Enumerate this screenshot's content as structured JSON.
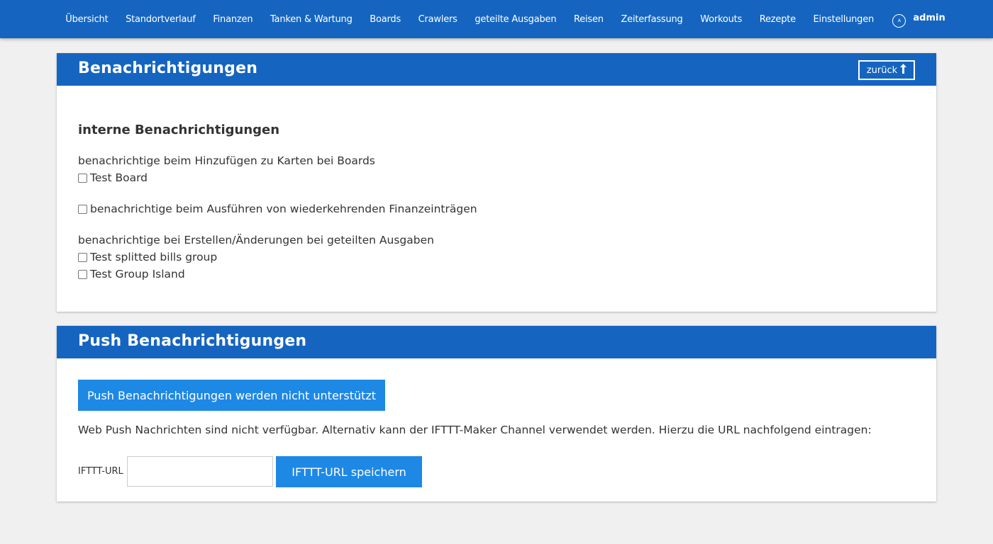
{
  "nav": {
    "items": [
      {
        "label": "Übersicht"
      },
      {
        "label": "Standortverlauf"
      },
      {
        "label": "Finanzen"
      },
      {
        "label": "Tanken & Wartung"
      },
      {
        "label": "Boards"
      },
      {
        "label": "Crawlers"
      },
      {
        "label": "geteilte Ausgaben"
      },
      {
        "label": "Reisen"
      },
      {
        "label": "Zeiterfassung"
      },
      {
        "label": "Workouts"
      },
      {
        "label": "Rezepte"
      },
      {
        "label": "Einstellungen"
      }
    ],
    "user": {
      "avatar_letter": "A",
      "name": "admin"
    }
  },
  "notifications": {
    "title": "Benachrichtigungen",
    "back_label": "zurück",
    "back_icon": "arrow-up-icon",
    "internal_heading": "interne Benachrichtigungen",
    "boards_label": "benachrichtige beim Hinzufügen zu Karten bei Boards",
    "boards_items": [
      {
        "label": "Test Board",
        "checked": false
      }
    ],
    "finance_label": "benachrichtige beim Ausführen von wiederkehrenden Finanzeinträgen",
    "finance_checked": false,
    "splitbills_label": "benachrichtige bei Erstellen/Änderungen bei geteilten Ausgaben",
    "splitbills_items": [
      {
        "label": "Test splitted bills group",
        "checked": false
      },
      {
        "label": "Test Group Island",
        "checked": false
      }
    ]
  },
  "push": {
    "title": "Push Benachrichtigungen",
    "unsupported_button": "Push Benachrichtigungen werden nicht unterstützt",
    "info_text": "Web Push Nachrichten sind nicht verfügbar. Alternativ kann der IFTTT-Maker Channel verwendet werden. Hierzu die URL nachfolgend eintragen:",
    "ifttt_label": "IFTTT-URL",
    "ifttt_value": "",
    "ifttt_placeholder": "",
    "save_label": "IFTTT-URL speichern"
  },
  "colors": {
    "primary": "#1565c0",
    "button": "#1e88e5",
    "background": "#f0f0f0"
  }
}
